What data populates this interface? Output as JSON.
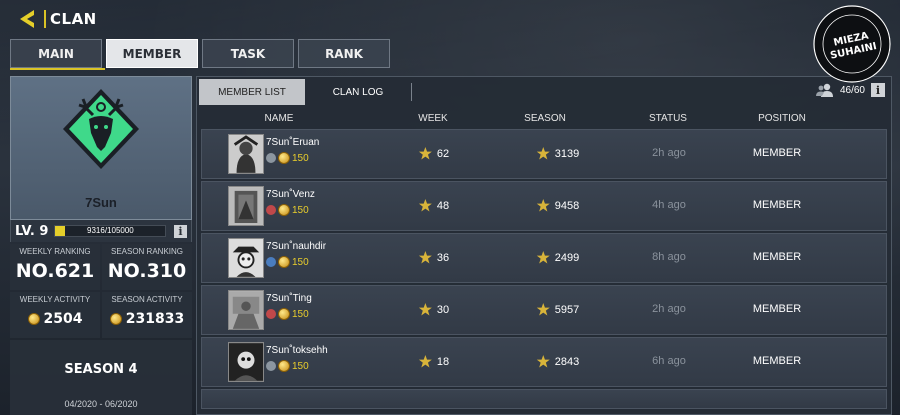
{
  "header": {
    "title": "CLAN"
  },
  "tabs": [
    {
      "label": "MAIN"
    },
    {
      "label": "MEMBER"
    },
    {
      "label": "TASK"
    },
    {
      "label": "RANK"
    }
  ],
  "clan": {
    "name": "7Sun",
    "level": "LV. 9",
    "xp": "9316/105000",
    "xp_fraction": 0.089,
    "weekly_ranking_label": "WEEKLY RANKING",
    "weekly_ranking": "NO.621",
    "season_ranking_label": "SEASON RANKING",
    "season_ranking": "NO.310",
    "weekly_activity_label": "WEEKLY ACTIVITY",
    "weekly_activity": "2504",
    "season_activity_label": "SEASON ACTIVITY",
    "season_activity": "231833",
    "season": "SEASON 4",
    "season_dates": "04/2020 - 06/2020",
    "emblem_color": "#3fd98a"
  },
  "panel": {
    "member_list_tab": "MEMBER LIST",
    "clan_log_tab": "CLAN LOG",
    "member_count": "46/60",
    "columns": {
      "name": "NAME",
      "week": "WEEK",
      "season": "SEASON",
      "status": "STATUS",
      "position": "POSITION"
    }
  },
  "members": [
    {
      "name": "7Sun˚Eruan",
      "points": "150",
      "week": "62",
      "season": "3139",
      "status": "2h ago",
      "position": "MEMBER"
    },
    {
      "name": "7Sun˚Venz",
      "points": "150",
      "week": "48",
      "season": "9458",
      "status": "4h ago",
      "position": "MEMBER"
    },
    {
      "name": "7Sun˚nauhdir",
      "points": "150",
      "week": "36",
      "season": "2499",
      "status": "8h ago",
      "position": "MEMBER"
    },
    {
      "name": "7Sun˚Ting",
      "points": "150",
      "week": "30",
      "season": "5957",
      "status": "2h ago",
      "position": "MEMBER"
    },
    {
      "name": "7Sun˚toksehh",
      "points": "150",
      "week": "18",
      "season": "2843",
      "status": "6h ago",
      "position": "MEMBER"
    }
  ],
  "watermark": {
    "line1": "MIEZA",
    "line2": "SUHAINI"
  },
  "colors": {
    "accent": "#d9c326",
    "gold_text": "#e8cd2c"
  }
}
